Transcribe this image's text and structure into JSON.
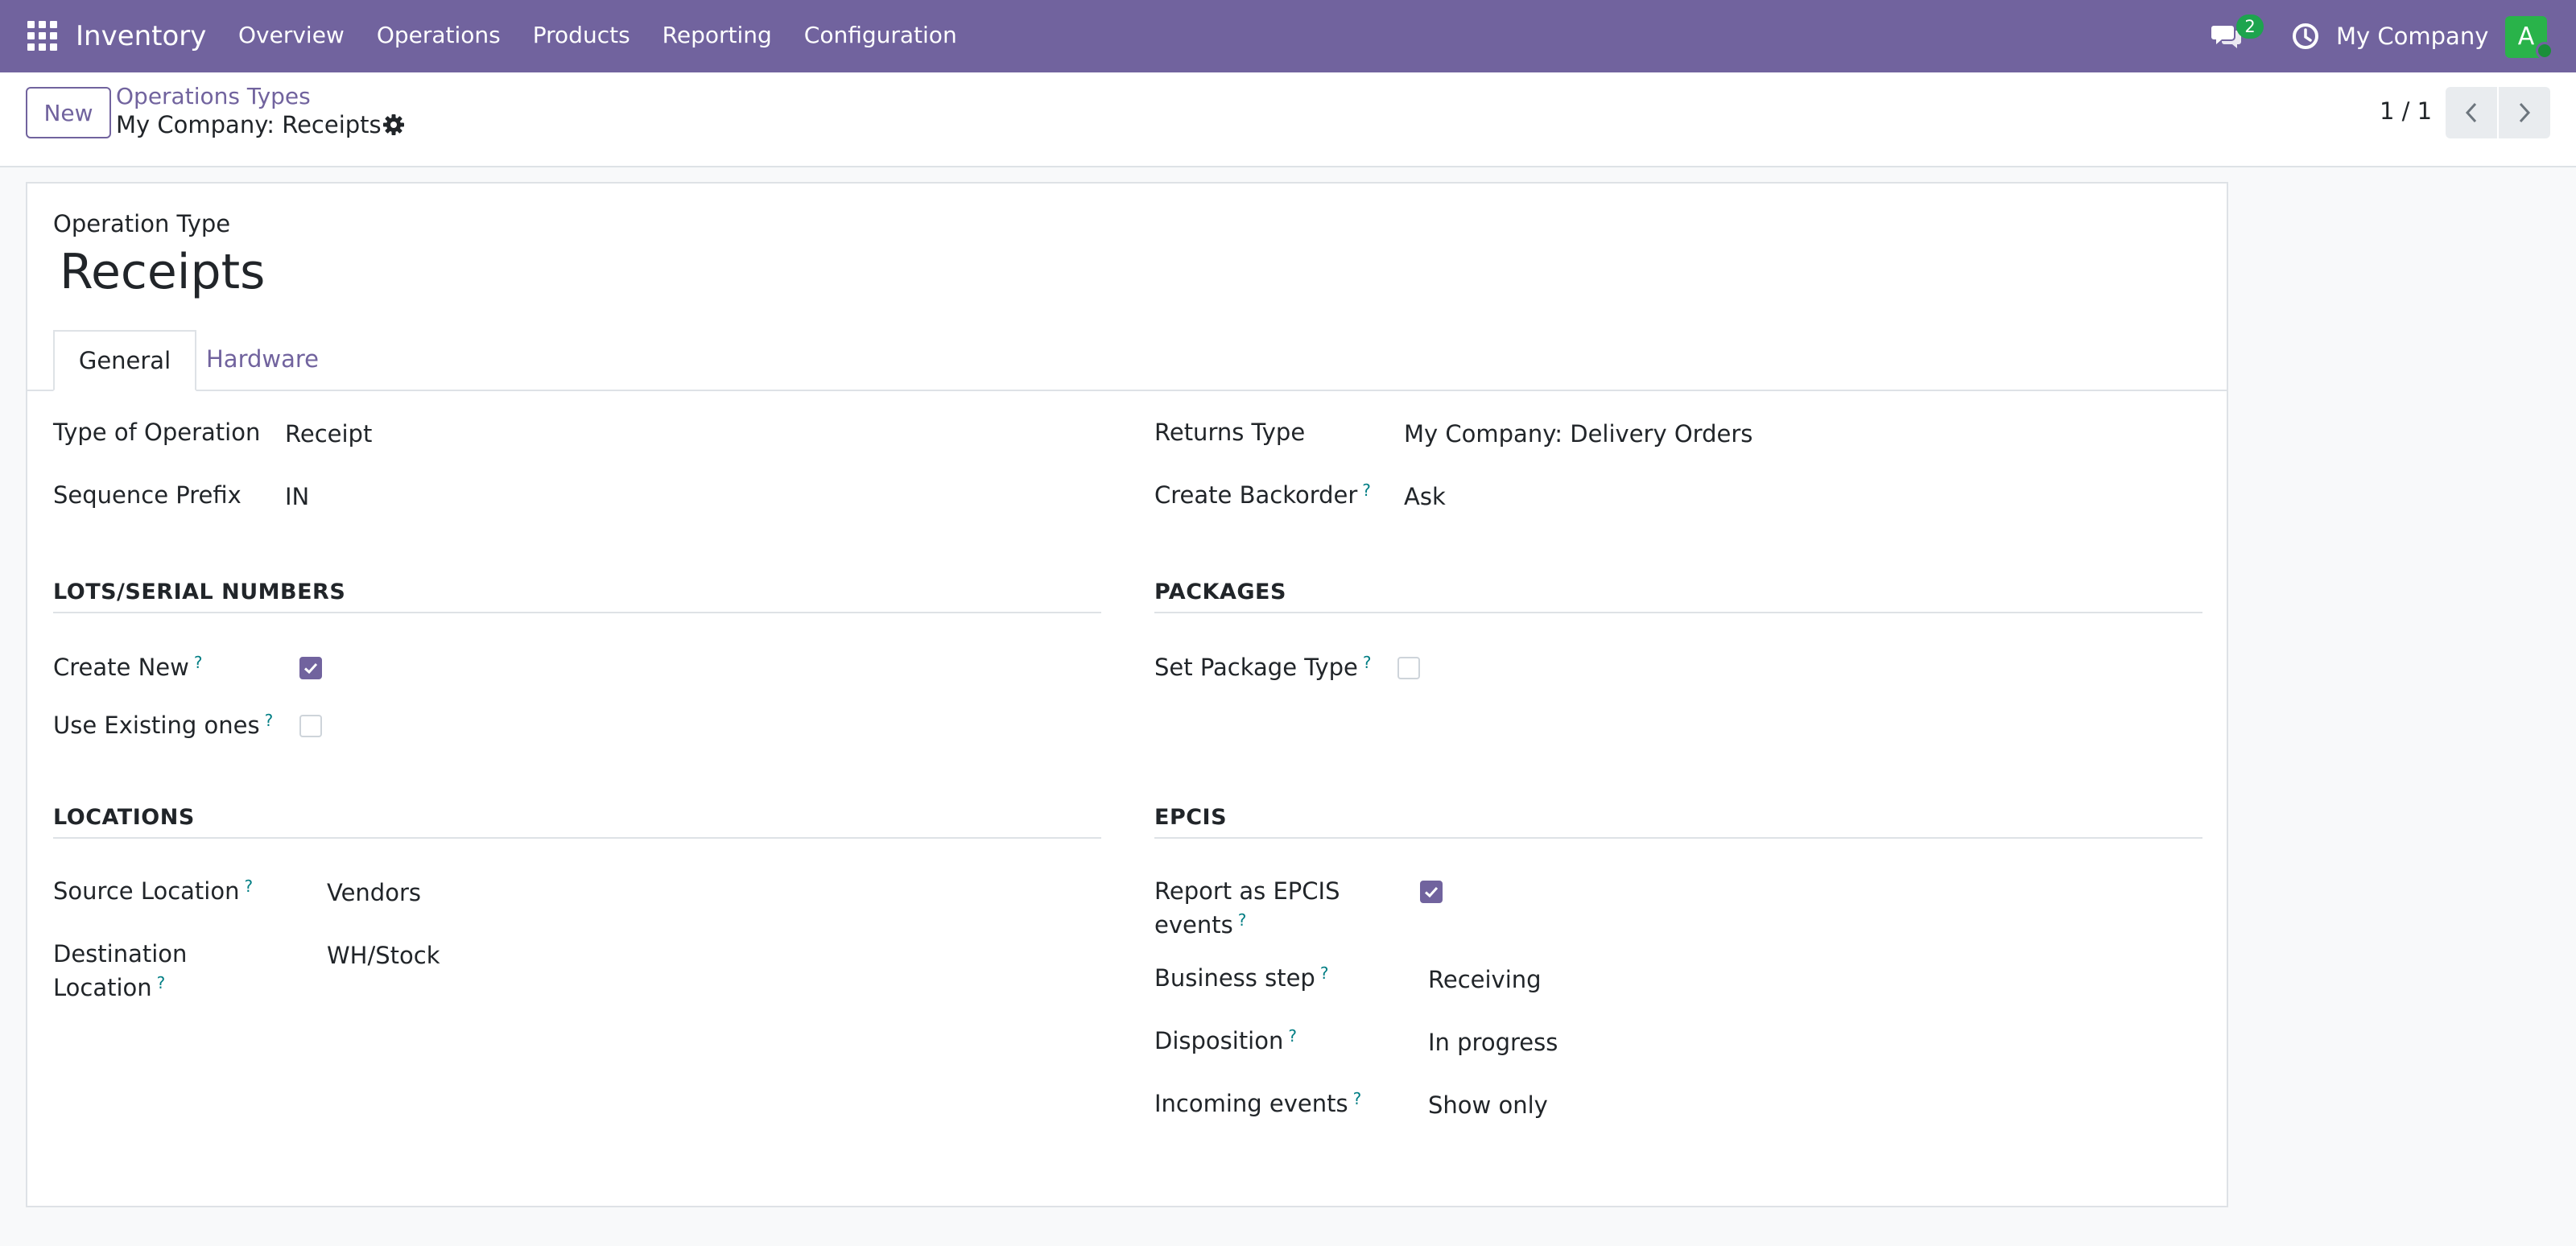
{
  "navbar": {
    "app_name": "Inventory",
    "menu": [
      "Overview",
      "Operations",
      "Products",
      "Reporting",
      "Configuration"
    ],
    "messages_count": "2",
    "company": "My Company",
    "avatar_initial": "A",
    "colors": {
      "primary": "#71639e",
      "avatar": "#29b34a",
      "badge": "#1da44e"
    }
  },
  "control_panel": {
    "new_button": "New",
    "breadcrumb_parent": "Operations Types",
    "breadcrumb_current": "My Company: Receipts",
    "pager": "1 / 1"
  },
  "form": {
    "caption": "Operation Type",
    "title": "Receipts",
    "tabs": [
      "General",
      "Hardware"
    ],
    "active_tab": "General",
    "left_fields": {
      "type_of_operation_label": "Type of Operation",
      "type_of_operation_value": "Receipt",
      "sequence_prefix_label": "Sequence Prefix",
      "sequence_prefix_value": "IN"
    },
    "right_fields": {
      "returns_type_label": "Returns Type",
      "returns_type_value": "My Company: Delivery Orders",
      "create_backorder_label": "Create Backorder",
      "create_backorder_value": "Ask"
    },
    "lots": {
      "title": "LOTS/SERIAL NUMBERS",
      "create_new_label": "Create New",
      "create_new_checked": true,
      "use_existing_label": "Use Existing ones",
      "use_existing_checked": false
    },
    "packages": {
      "title": "PACKAGES",
      "set_package_type_label": "Set Package Type",
      "set_package_type_checked": false
    },
    "locations": {
      "title": "LOCATIONS",
      "source_label": "Source Location",
      "source_value": "Vendors",
      "destination_label_line1": "Destination",
      "destination_label_line2": "Location",
      "destination_value": "WH/Stock"
    },
    "epcis": {
      "title": "EPCIS",
      "report_label_line1": "Report as EPCIS",
      "report_label_line2": "events",
      "report_checked": true,
      "business_step_label": "Business step",
      "business_step_value": "Receiving",
      "disposition_label": "Disposition",
      "disposition_value": "In progress",
      "incoming_events_label": "Incoming events",
      "incoming_events_value": "Show only"
    },
    "help_mark": "?"
  }
}
